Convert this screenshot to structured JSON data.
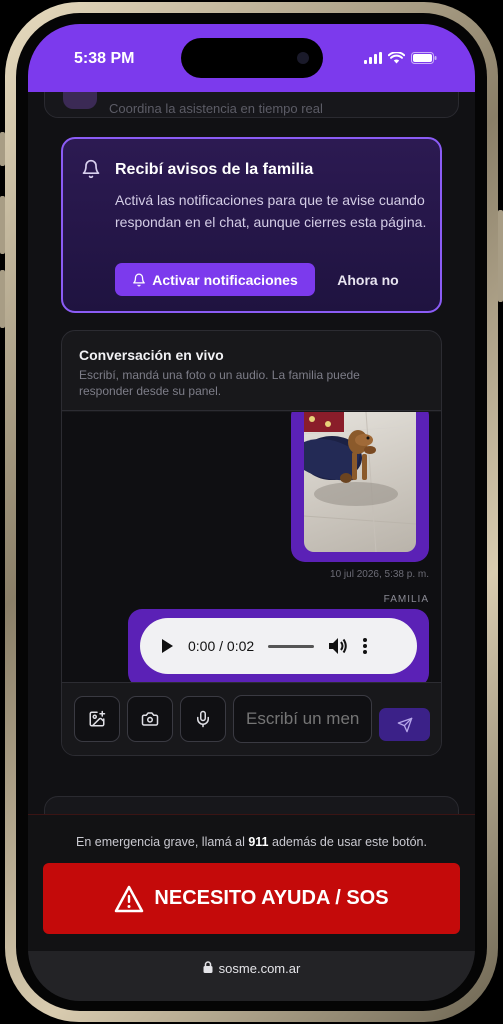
{
  "status_bar": {
    "time": "5:38 PM",
    "icons": [
      "signal-icon",
      "wifi-icon",
      "battery-icon"
    ]
  },
  "top_card": {
    "subtitle": "Coordina la asistencia en tiempo real"
  },
  "notifications": {
    "title": "Recibí avisos de la familia",
    "body": "Activá las notificaciones para que te avise cuando respondan en el chat, aunque cierres esta página.",
    "activate_label": "Activar notificaciones",
    "later_label": "Ahora no",
    "icon": "bell-icon"
  },
  "chat": {
    "title": "Conversación en vivo",
    "subtitle": "Escribí, mandá una foto o un audio. La familia puede responder desde su panel.",
    "messages": [
      {
        "type": "image",
        "timestamp": "10 jul 2026, 5:38 p. m."
      },
      {
        "type": "audio",
        "sender": "FAMILIA",
        "time_display": "0:00 / 0:02"
      }
    ],
    "composer": {
      "placeholder": "Escribí un mensaje",
      "buttons": [
        "image-upload-icon",
        "camera-icon",
        "microphone-icon",
        "send-icon"
      ]
    }
  },
  "footer": {
    "warning_pre": "En emergencia grave, llamá al ",
    "warning_number": "911",
    "warning_post": " además de usar este botón.",
    "sos_label": "NECESITO AYUDA / SOS"
  },
  "browser": {
    "url": "sosme.com.ar"
  },
  "colors": {
    "accent": "#7c3aed",
    "bubble": "#5b21b6",
    "sos": "#c40a0a"
  }
}
